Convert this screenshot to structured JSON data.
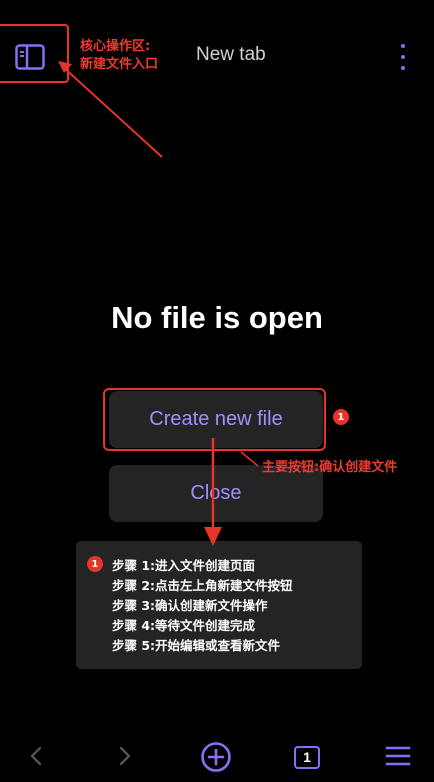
{
  "header": {
    "tab_title": "New tab",
    "sidebar_icon": "sidebar-icon",
    "menu_icon": "more-vertical-icon"
  },
  "main": {
    "heading": "No file is open",
    "create_label": "Create new file",
    "close_label": "Close"
  },
  "annotations": {
    "core_area": [
      "核心操作区:",
      "新建文件入口"
    ],
    "primary_button": "主要按钮:确认创建文件",
    "badge_1": "1",
    "badge_2": "1",
    "steps": [
      "步骤 1:进入文件创建页面",
      "步骤 2:点击左上角新建文件按钮",
      "步骤 3:确认创建新文件操作",
      "步骤 4:等待文件创建完成",
      "步骤 5:开始编辑或查看新文件"
    ],
    "highlight_color": "#e5352b"
  },
  "bottom_nav": {
    "back_icon": "chevron-left-icon",
    "forward_icon": "chevron-right-icon",
    "add_icon": "plus-circle-icon",
    "tab_count": "1",
    "menu_icon": "hamburger-menu-icon"
  },
  "colors": {
    "background": "#000000",
    "accent": "#8c6cf2",
    "button_text": "#a98bff",
    "button_bg": "#242424"
  }
}
